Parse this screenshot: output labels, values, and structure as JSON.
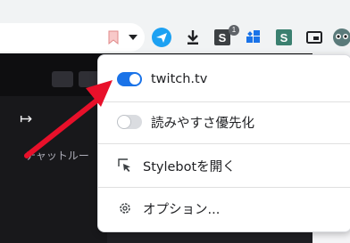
{
  "browser": {
    "extension_badge": "1"
  },
  "page": {
    "chat_label": "チャットルー"
  },
  "popup": {
    "site_toggle_label": "twitch.tv",
    "site_toggle_on": true,
    "readability_label": "読みやすさ優先化",
    "readability_on": false,
    "open_stylebot_label": "Stylebotを開く",
    "options_label": "オプション..."
  },
  "colors": {
    "accent": "#1a73e8",
    "annotation_arrow": "#e8102a",
    "page_background": "#18181b"
  },
  "icons": [
    "bookmark-icon",
    "dropdown-icon",
    "airplane-extension-icon",
    "download-icon",
    "stylebot-extension-icon",
    "puzzle-extension-icon",
    "s-extension-icon",
    "picture-in-picture-icon",
    "profile-icon",
    "collapse-arrow-icon",
    "select-element-icon",
    "gear-icon"
  ]
}
